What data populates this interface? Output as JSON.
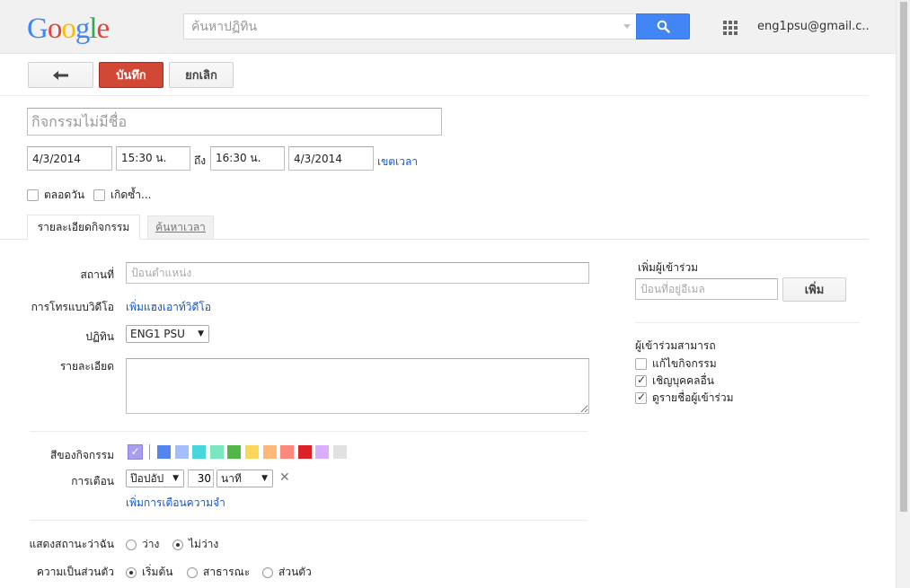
{
  "header": {
    "logo": "Google",
    "search_placeholder": "ค้นหาปฏิทิน",
    "account": "eng1psu@gmail.c..."
  },
  "toolbar": {
    "back_label": "←",
    "save_label": "บันทึก",
    "cancel_label": "ยกเลิก"
  },
  "event": {
    "title_placeholder": "กิจกรรมไม่มีชื่อ",
    "start_date": "4/3/2014",
    "start_time": "15:30 น.",
    "to_label": "ถึง",
    "end_time": "16:30 น.",
    "end_date": "4/3/2014",
    "timezone_link": "เขตเวลา",
    "all_day_label": "ตลอดวัน",
    "repeat_label": "เกิดซ้ำ..."
  },
  "tabs": [
    {
      "label": "รายละเอียดกิจกรรม",
      "active": true
    },
    {
      "label": "ค้นหาเวลา",
      "active": false
    }
  ],
  "details": {
    "location_label": "สถานที่",
    "location_placeholder": "ป้อนตำแหน่ง",
    "video_call_label": "การโทรแบบวิดีโอ",
    "video_call_link": "เพิ่มแฮงเอาท์วิดีโอ",
    "calendar_label": "ปฏิทิน",
    "calendar_value": "ENG1 PSU",
    "description_label": "รายละเอียด",
    "color_label": "สีของกิจกรรม",
    "colors": [
      "#5484ed",
      "#a4bdfc",
      "#46d6db",
      "#7ae7bf",
      "#51b749",
      "#fbd75b",
      "#ffb878",
      "#ff887c",
      "#dc2127",
      "#dbadff",
      "#e1e1e1"
    ],
    "selected_color": "#a79ef0",
    "reminder_label": "การเตือน",
    "reminder_type": "ป๊อปอัป",
    "reminder_amount": "30",
    "reminder_unit": "นาที",
    "add_reminder_link": "เพิ่มการเตือนความจำ",
    "show_me_as_label": "แสดงสถานะว่าฉัน",
    "show_me_as_options": [
      "ว่าง",
      "ไม่ว่าง"
    ],
    "show_me_as_selected": "ไม่ว่าง",
    "privacy_label": "ความเป็นส่วนตัว",
    "privacy_options": [
      "เริ่มต้น",
      "สาธารณะ",
      "ส่วนตัว"
    ],
    "privacy_selected": "เริ่มต้น"
  },
  "guests": {
    "title": "เพิ่มผู้เข้าร่วม",
    "email_placeholder": "ป้อนที่อยู่อีเมล",
    "add_label": "เพิ่ม",
    "can_title": "ผู้เข้าร่วมสามารถ",
    "permissions": [
      {
        "label": "แก้ไขกิจกรรม",
        "checked": false
      },
      {
        "label": "เชิญบุคคลอื่น",
        "checked": true
      },
      {
        "label": "ดูรายชื่อผู้เข้าร่วม",
        "checked": true
      }
    ]
  }
}
